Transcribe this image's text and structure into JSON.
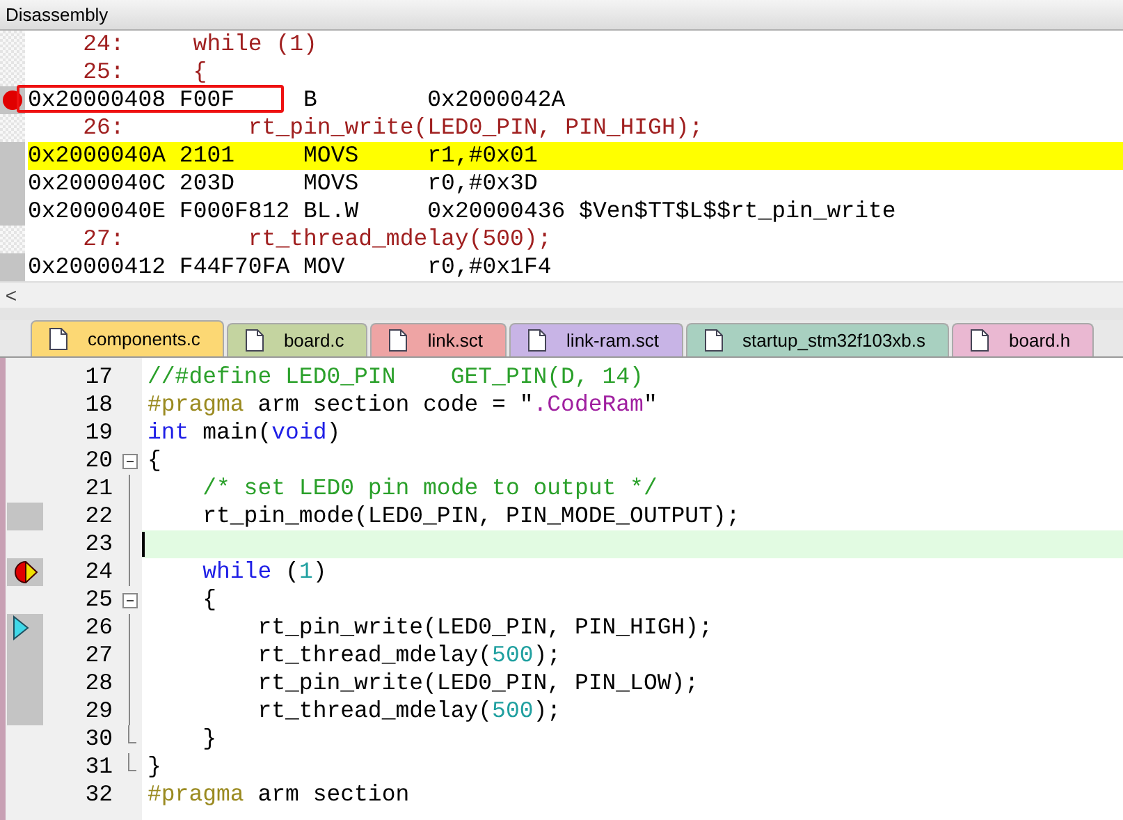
{
  "disassembly": {
    "title": "Disassembly",
    "rows": [
      {
        "kind": "source",
        "line": "24:",
        "code": "    while (1)"
      },
      {
        "kind": "source",
        "line": "25:",
        "code": "    {"
      },
      {
        "kind": "asm",
        "address": "0x20000408",
        "opcode": "F00F",
        "mnemonic": "B",
        "operands": "0x2000042A",
        "breakpoint": true,
        "annotated": true,
        "current": false
      },
      {
        "kind": "source",
        "line": "26:",
        "code": "        rt_pin_write(LED0_PIN, PIN_HIGH);"
      },
      {
        "kind": "asm",
        "address": "0x2000040A",
        "opcode": "2101",
        "mnemonic": "MOVS",
        "operands": "r1,#0x01",
        "breakpoint": false,
        "annotated": false,
        "current": true
      },
      {
        "kind": "asm",
        "address": "0x2000040C",
        "opcode": "203D",
        "mnemonic": "MOVS",
        "operands": "r0,#0x3D",
        "breakpoint": false,
        "annotated": false,
        "current": false
      },
      {
        "kind": "asm",
        "address": "0x2000040E",
        "opcode": "F000F812",
        "mnemonic": "BL.W",
        "operands": "0x20000436 $Ven$TT$L$$rt_pin_write",
        "breakpoint": false,
        "annotated": false,
        "current": false
      },
      {
        "kind": "source",
        "line": "27:",
        "code": "        rt_thread_mdelay(500);"
      },
      {
        "kind": "asm",
        "address": "0x20000412",
        "opcode": "F44F70FA",
        "mnemonic": "MOV",
        "operands": "r0,#0x1F4",
        "breakpoint": false,
        "annotated": false,
        "current": false
      }
    ],
    "scroll_left": "<"
  },
  "tabs": [
    {
      "label": "components.c",
      "selected": true,
      "color": "#fcd874"
    },
    {
      "label": "board.c",
      "selected": false,
      "color": "#c4d4a0"
    },
    {
      "label": "link.sct",
      "selected": false,
      "color": "#eea4a4"
    },
    {
      "label": "link-ram.sct",
      "selected": false,
      "color": "#c8b4e6"
    },
    {
      "label": "startup_stm32f103xb.s",
      "selected": false,
      "color": "#a8d0c0"
    },
    {
      "label": "board.h",
      "selected": false,
      "color": "#eab8d2"
    }
  ],
  "editor": {
    "lines": [
      {
        "number": "17",
        "covered": false,
        "breakpoint": false,
        "execution_point": false,
        "call_arrow": false,
        "fold_start": false,
        "fold_body": false,
        "fold_end": false,
        "current": false,
        "tokens": [
          {
            "kind": "comment",
            "text": "//#define LED0_PIN    GET_PIN(D, 14)"
          }
        ]
      },
      {
        "number": "18",
        "covered": false,
        "breakpoint": false,
        "execution_point": false,
        "call_arrow": false,
        "fold_start": false,
        "fold_body": false,
        "fold_end": false,
        "current": false,
        "tokens": [
          {
            "kind": "preproc",
            "text": "#pragma"
          },
          {
            "kind": "plain",
            "text": " arm section code = \""
          },
          {
            "kind": "string",
            "text": ".CodeRam"
          },
          {
            "kind": "plain",
            "text": "\""
          }
        ]
      },
      {
        "number": "19",
        "covered": false,
        "breakpoint": false,
        "execution_point": false,
        "call_arrow": false,
        "fold_start": false,
        "fold_body": false,
        "fold_end": false,
        "current": false,
        "tokens": [
          {
            "kind": "keyword",
            "text": "int"
          },
          {
            "kind": "plain",
            "text": " main("
          },
          {
            "kind": "keyword",
            "text": "void"
          },
          {
            "kind": "plain",
            "text": ")"
          }
        ]
      },
      {
        "number": "20",
        "covered": false,
        "breakpoint": false,
        "execution_point": false,
        "call_arrow": false,
        "fold_start": true,
        "fold_body": false,
        "fold_end": false,
        "current": false,
        "tokens": [
          {
            "kind": "plain",
            "text": "{"
          }
        ]
      },
      {
        "number": "21",
        "covered": false,
        "breakpoint": false,
        "execution_point": false,
        "call_arrow": false,
        "fold_start": false,
        "fold_body": true,
        "fold_end": false,
        "current": false,
        "tokens": [
          {
            "kind": "comment",
            "text": "    /* set LED0 pin mode to output */"
          }
        ]
      },
      {
        "number": "22",
        "covered": true,
        "breakpoint": false,
        "execution_point": false,
        "call_arrow": false,
        "fold_start": false,
        "fold_body": true,
        "fold_end": false,
        "current": false,
        "tokens": [
          {
            "kind": "plain",
            "text": "    rt_pin_mode(LED0_PIN, PIN_MODE_OUTPUT);"
          }
        ]
      },
      {
        "number": "23",
        "covered": false,
        "breakpoint": false,
        "execution_point": false,
        "call_arrow": false,
        "fold_start": false,
        "fold_body": true,
        "fold_end": false,
        "current": true
      },
      {
        "number": "24",
        "covered": true,
        "breakpoint": true,
        "execution_point": true,
        "call_arrow": false,
        "fold_start": false,
        "fold_body": true,
        "fold_end": false,
        "current": false,
        "tokens": [
          {
            "kind": "keyword",
            "text": "    while"
          },
          {
            "kind": "plain",
            "text": " ("
          },
          {
            "kind": "number",
            "text": "1"
          },
          {
            "kind": "plain",
            "text": ")"
          }
        ]
      },
      {
        "number": "25",
        "covered": false,
        "breakpoint": false,
        "execution_point": false,
        "call_arrow": false,
        "fold_start": true,
        "fold_body": false,
        "fold_end": false,
        "current": false,
        "tokens": [
          {
            "kind": "plain",
            "text": "    {"
          }
        ]
      },
      {
        "number": "26",
        "covered": true,
        "breakpoint": false,
        "execution_point": false,
        "call_arrow": true,
        "fold_start": false,
        "fold_body": true,
        "fold_end": false,
        "current": false,
        "tokens": [
          {
            "kind": "plain",
            "text": "        rt_pin_write(LED0_PIN, PIN_HIGH);"
          }
        ]
      },
      {
        "number": "27",
        "covered": true,
        "breakpoint": false,
        "execution_point": false,
        "call_arrow": false,
        "fold_start": false,
        "fold_body": true,
        "fold_end": false,
        "current": false,
        "tokens": [
          {
            "kind": "plain",
            "text": "        rt_thread_mdelay("
          },
          {
            "kind": "number",
            "text": "500"
          },
          {
            "kind": "plain",
            "text": ");"
          }
        ]
      },
      {
        "number": "28",
        "covered": true,
        "breakpoint": false,
        "execution_point": false,
        "call_arrow": false,
        "fold_start": false,
        "fold_body": true,
        "fold_end": false,
        "current": false,
        "tokens": [
          {
            "kind": "plain",
            "text": "        rt_pin_write(LED0_PIN, PIN_LOW);"
          }
        ]
      },
      {
        "number": "29",
        "covered": true,
        "breakpoint": false,
        "execution_point": false,
        "call_arrow": false,
        "fold_start": false,
        "fold_body": true,
        "fold_end": false,
        "current": false,
        "tokens": [
          {
            "kind": "plain",
            "text": "        rt_thread_mdelay("
          },
          {
            "kind": "number",
            "text": "500"
          },
          {
            "kind": "plain",
            "text": ");"
          }
        ]
      },
      {
        "number": "30",
        "covered": false,
        "breakpoint": false,
        "execution_point": false,
        "call_arrow": false,
        "fold_start": false,
        "fold_body": false,
        "fold_end": true,
        "current": false,
        "tokens": [
          {
            "kind": "plain",
            "text": "    }"
          }
        ]
      },
      {
        "number": "31",
        "covered": false,
        "breakpoint": false,
        "execution_point": false,
        "call_arrow": false,
        "fold_start": false,
        "fold_body": false,
        "fold_end": true,
        "current": false,
        "tokens": [
          {
            "kind": "plain",
            "text": "}"
          }
        ]
      },
      {
        "number": "32",
        "covered": false,
        "breakpoint": false,
        "execution_point": false,
        "call_arrow": false,
        "fold_start": false,
        "fold_body": false,
        "fold_end": false,
        "current": false,
        "tokens": [
          {
            "kind": "preproc",
            "text": "#pragma"
          },
          {
            "kind": "plain",
            "text": " arm section"
          }
        ]
      }
    ]
  }
}
